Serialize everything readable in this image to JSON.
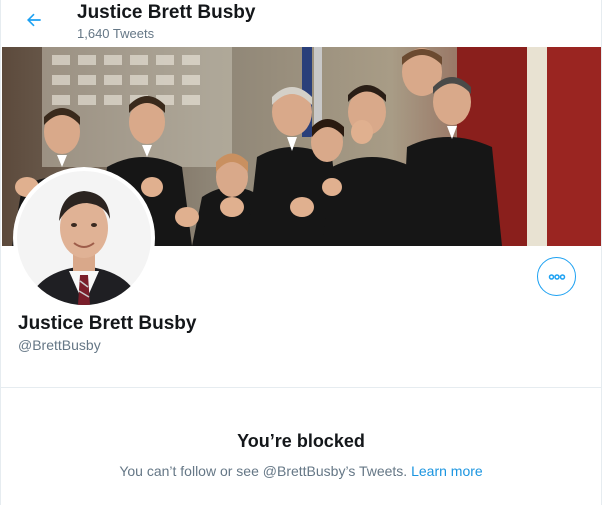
{
  "header": {
    "title": "Justice Brett Busby",
    "tweet_count": "1,640 Tweets"
  },
  "profile": {
    "name": "Justice Brett Busby",
    "handle": "@BrettBusby"
  },
  "blocked": {
    "title": "You’re blocked",
    "message": "You can’t follow or see @BrettBusby’s Tweets.",
    "link": "Learn more"
  },
  "colors": {
    "accent": "#1da1f2",
    "link": "#1b95e0",
    "secondary_text": "#657786"
  }
}
